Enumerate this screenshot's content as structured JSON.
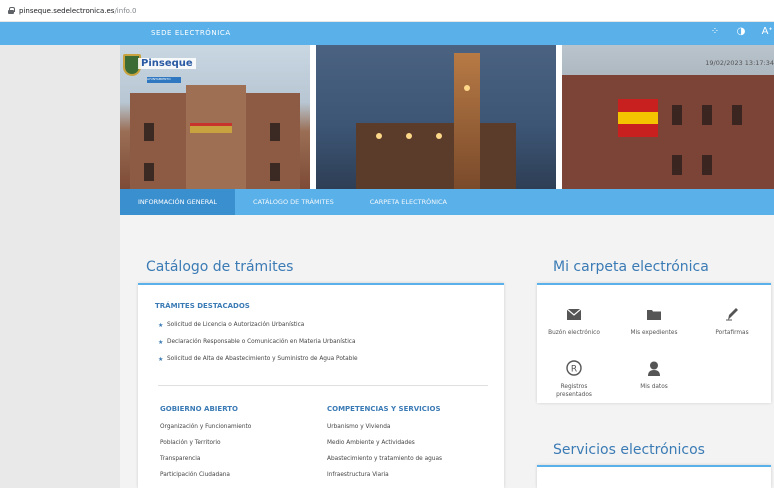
{
  "browser": {
    "host": "pinseque.sedelectronica.es",
    "path": "/info.0"
  },
  "topbar": {
    "title": "SEDE ELECTRÓNICA",
    "tools": [
      "apps-icon",
      "contrast-icon",
      "text-size-icon"
    ],
    "tool_glyphs": [
      "⁘",
      "◑",
      "Aᐩ"
    ]
  },
  "hero": {
    "logo_text": "Pinseque",
    "logo_sub": "AYUNTAMIENTO",
    "datetime": "19/02/2023 13:17:34"
  },
  "nav": {
    "tabs": [
      {
        "label": "INFORMACIÓN GENERAL"
      },
      {
        "label": "CATÁLOGO DE TRÁMITES"
      },
      {
        "label": "CARPETA ELECTRÓNICA"
      }
    ]
  },
  "catalog": {
    "title": "Catálogo de trámites",
    "featured_title": "TRÁMITES DESTACADOS",
    "featured": [
      "Solicitud de Licencia o Autorización Urbanística",
      "Declaración Responsable o Comunicación en Materia Urbanística",
      "Solicitud de Alta de Abastecimiento y Suministro de Agua Potable"
    ],
    "col1": {
      "title": "GOBIERNO ABIERTO",
      "items": [
        "Organización y Funcionamiento",
        "Población y Territorio",
        "Transparencia",
        "Participación Ciudadana"
      ]
    },
    "col2": {
      "title": "COMPETENCIAS Y SERVICIOS",
      "items": [
        "Urbanismo y Vivienda",
        "Medio Ambiente y Actividades",
        "Abastecimiento y tratamiento de aguas",
        "Infraestructura Viaria"
      ]
    }
  },
  "folder": {
    "title": "Mi carpeta electrónica",
    "items": [
      {
        "icon": "envelope-icon",
        "label": "Buzón electrónico"
      },
      {
        "icon": "folder-icon",
        "label": "Mis expedientes"
      },
      {
        "icon": "pen-icon",
        "label": "Portafirmas"
      },
      {
        "icon": "registered-icon",
        "label": "Registros presentados"
      },
      {
        "icon": "user-icon",
        "label": "Mis datos"
      }
    ]
  },
  "services": {
    "title": "Servicios electrónicos"
  },
  "colors": {
    "primary": "#5ab1ea",
    "active_tab": "#3a8fcf",
    "heading": "#3b7bb5",
    "page_bg": "#f3f3f3"
  }
}
